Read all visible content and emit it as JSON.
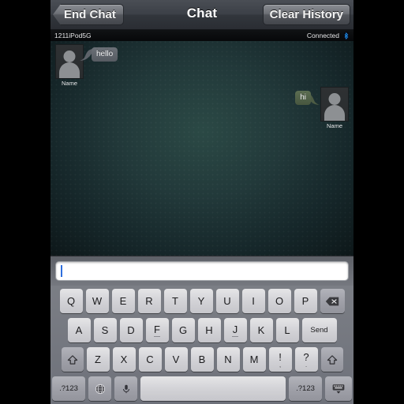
{
  "navbar": {
    "title": "Chat",
    "left_button": "End Chat",
    "right_button": "Clear History"
  },
  "statusbar": {
    "device": "1211iPod5G",
    "connection": "Connected",
    "bluetooth_icon": "bluetooth-icon"
  },
  "chat": {
    "messages": [
      {
        "side": "incoming",
        "text": "hello",
        "sender_name": "Name",
        "avatar_icon": "person-silhouette-icon"
      },
      {
        "side": "outgoing",
        "text": "hi",
        "sender_name": "Name",
        "avatar_icon": "person-silhouette-icon"
      }
    ]
  },
  "input": {
    "value": "",
    "placeholder": ""
  },
  "keyboard": {
    "row1": [
      {
        "main": "Q"
      },
      {
        "main": "W"
      },
      {
        "main": "E"
      },
      {
        "main": "R"
      },
      {
        "main": "T"
      },
      {
        "main": "Y"
      },
      {
        "main": "U"
      },
      {
        "main": "I"
      },
      {
        "main": "O"
      },
      {
        "main": "P"
      }
    ],
    "backspace_label": "backspace-icon",
    "row2": [
      {
        "main": "A"
      },
      {
        "main": "S"
      },
      {
        "main": "D"
      },
      {
        "main": "F"
      },
      {
        "main": "G"
      },
      {
        "main": "H"
      },
      {
        "main": "J"
      },
      {
        "main": "K"
      },
      {
        "main": "L"
      }
    ],
    "send_label": "Send",
    "row3": [
      {
        "main": "Z"
      },
      {
        "main": "X"
      },
      {
        "main": "C"
      },
      {
        "main": "V"
      },
      {
        "main": "B"
      },
      {
        "main": "N"
      },
      {
        "main": "M"
      }
    ],
    "punct": [
      {
        "main": "!",
        "sub": ","
      },
      {
        "main": "?",
        "sub": "."
      }
    ],
    "shift_label": "shift-icon",
    "numeric_label": ".?123",
    "globe_label": "globe-icon",
    "mic_label": "microphone-icon",
    "space_label": "",
    "dismiss_label": "dismiss-keyboard-icon"
  },
  "colors": {
    "accent_bluetooth": "#1e8ff0",
    "caret": "#2f6fdd",
    "chat_background": "#22393a",
    "bubble_incoming": "#565b62",
    "bubble_outgoing": "#47563f",
    "keyboard_background": "#72757d",
    "key_face": "#d2d2d6"
  }
}
